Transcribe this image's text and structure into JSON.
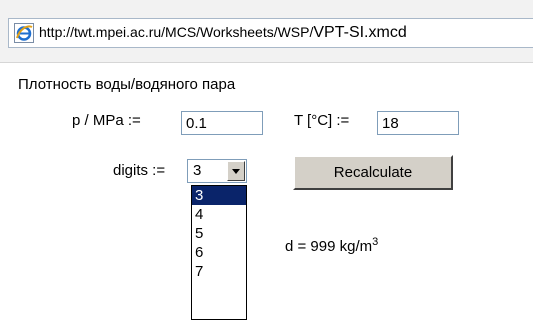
{
  "browser": {
    "url_prefix": "http://twt.mpei.ac.ru/MCS/Worksheets/WSP/",
    "url_file": "VPT-SI.xmcd"
  },
  "page": {
    "title": "Плотность воды/водяного пара"
  },
  "form": {
    "pressure": {
      "label": "p / MPa :=",
      "value": "0.1"
    },
    "temperature": {
      "label": "T [°C] :=",
      "value": "18"
    },
    "digits": {
      "label": "digits :=",
      "selected": "3",
      "options": [
        "3",
        "4",
        "5",
        "6",
        "7"
      ]
    },
    "recalculate_label": "Recalculate"
  },
  "result": {
    "prefix": "d = 999",
    "unit": "kg/m",
    "exponent": "3"
  },
  "colors": {
    "selection": "#0a246a",
    "button_face": "#d4d0c8"
  },
  "icons": {
    "browser": "ie-page-icon",
    "dropdown": "chevron-down-icon"
  }
}
